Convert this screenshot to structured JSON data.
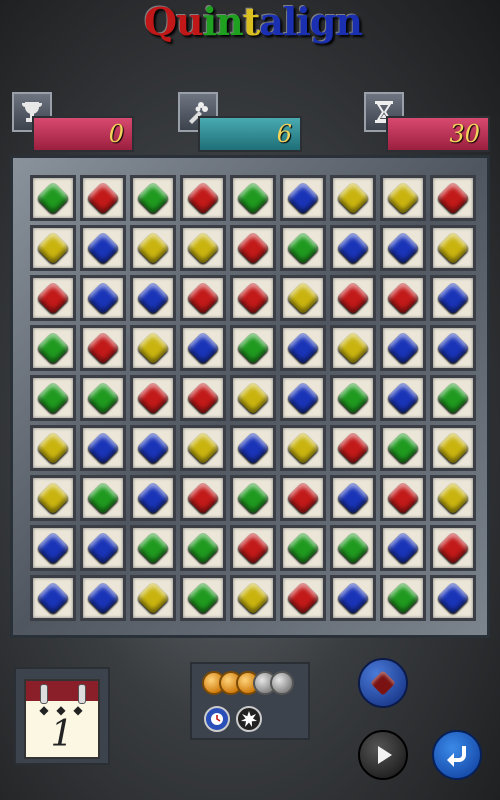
{
  "title": "Quintalign",
  "title_letters": [
    {
      "ch": "Q",
      "color": "#c01818"
    },
    {
      "ch": "u",
      "color": "#c01818"
    },
    {
      "ch": "i",
      "color": "#20a020"
    },
    {
      "ch": "n",
      "color": "#20a020"
    },
    {
      "ch": "t",
      "color": "#d9c020"
    },
    {
      "ch": "a",
      "color": "#1a30b0"
    },
    {
      "ch": "l",
      "color": "#1a30b0"
    },
    {
      "ch": "i",
      "color": "#1a30b0"
    },
    {
      "ch": "g",
      "color": "#1a30b0"
    },
    {
      "ch": "n",
      "color": "#1a30b0"
    }
  ],
  "stats": {
    "score": {
      "icon": "trophy-icon",
      "value": "0",
      "color": "#b3254c"
    },
    "moves": {
      "icon": "bouquet-icon",
      "value": "6",
      "color": "#2a8a93"
    },
    "time": {
      "icon": "hourglass-icon",
      "value": "30",
      "color": "#b3254c"
    }
  },
  "board": {
    "rows": [
      [
        "green",
        "red",
        "green",
        "red",
        "green",
        "blue",
        "yellow",
        "yellow",
        "red"
      ],
      [
        "yellow",
        "blue",
        "yellow",
        "yellow",
        "red",
        "green",
        "blue",
        "blue",
        "yellow"
      ],
      [
        "red",
        "blue",
        "blue",
        "red",
        "red",
        "yellow",
        "red",
        "red",
        "blue"
      ],
      [
        "green",
        "red",
        "yellow",
        "blue",
        "green",
        "blue",
        "yellow",
        "blue",
        "blue"
      ],
      [
        "green",
        "green",
        "red",
        "red",
        "yellow",
        "blue",
        "green",
        "blue",
        "green"
      ],
      [
        "yellow",
        "blue",
        "blue",
        "yellow",
        "blue",
        "yellow",
        "red",
        "green",
        "yellow"
      ],
      [
        "yellow",
        "green",
        "blue",
        "red",
        "green",
        "red",
        "blue",
        "red",
        "yellow"
      ],
      [
        "blue",
        "blue",
        "green",
        "green",
        "red",
        "green",
        "green",
        "blue",
        "red"
      ],
      [
        "blue",
        "blue",
        "yellow",
        "green",
        "yellow",
        "red",
        "blue",
        "green",
        "blue"
      ]
    ]
  },
  "level": "1",
  "bonus": {
    "coins": [
      "gold",
      "gold",
      "gold",
      "gray",
      "gray"
    ],
    "powerups": [
      "clock-icon",
      "burst-icon"
    ]
  },
  "controls": {
    "next_gem_color": "red",
    "buttons": [
      "next-gem-button",
      "play-button",
      "undo-button"
    ]
  },
  "colors": {
    "green": "#1f9a1f",
    "red": "#c21919",
    "blue": "#1a34b8",
    "yellow": "#c9b40f"
  }
}
